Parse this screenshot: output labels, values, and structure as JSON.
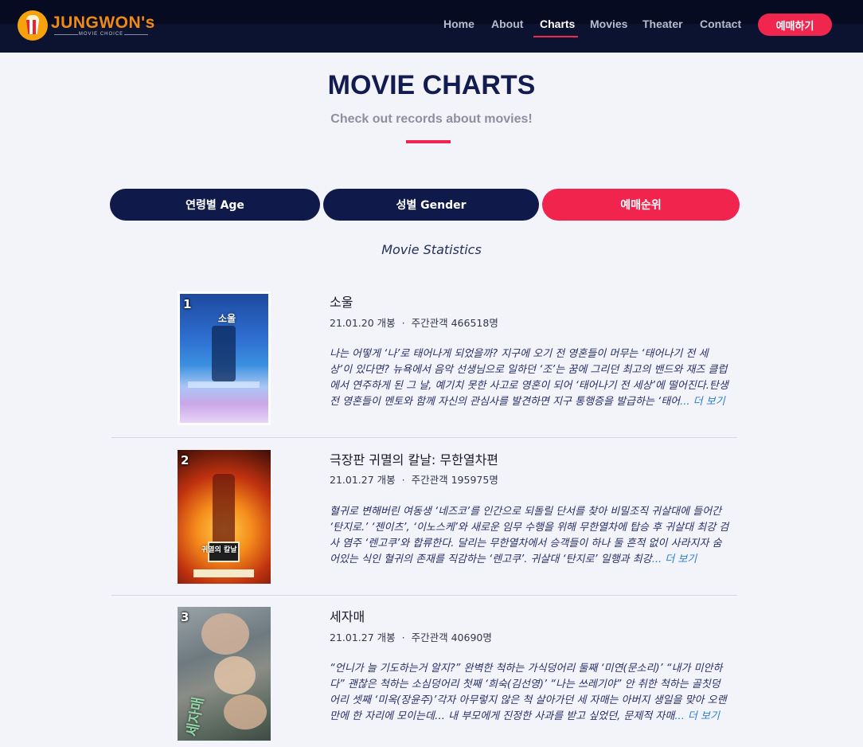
{
  "header": {
    "logo_text": "JUNGWON's",
    "logo_sub": "MOVIE CHOICE",
    "nav": [
      "Home",
      "About",
      "Charts",
      "Movies",
      "Theater",
      "Contact"
    ],
    "active_nav": "Charts",
    "reserve_label": "예매하기"
  },
  "page": {
    "title": "MOVIE CHARTS",
    "subtitle": "Check out records about movies!",
    "tabs": [
      {
        "label": "연령별 Age",
        "active": false
      },
      {
        "label": "성별 Gender",
        "active": false
      },
      {
        "label": "예매순위",
        "active": true
      }
    ],
    "stats_label": "Movie Statistics"
  },
  "movies": [
    {
      "rank": "1",
      "title": "소울",
      "release": "21.01.20 개봉",
      "audience": "주간관객 466518명",
      "description": "나는 어떻게 ‘나’로 태어나게 되었을까? 지구에 오기 전 영혼들이 머무는 ‘태어나기 전 세상’이 있다면? 뉴욕에서 음악 선생님으로 일하던 ‘조’는 꿈에 그리던 최고의 밴드와 재즈 클럽에서 연주하게 된 그 날, 예기치 못한 사고로 영혼이 되어 ‘태어나기 전 세상’에 떨어진다.탄생 전 영혼들이 멘토와 함께 자신의 관심사를 발견하면 지구 통행증을 발급하는 ‘태어",
      "more": "... 더 보기"
    },
    {
      "rank": "2",
      "title": "극장판 귀멸의 칼날: 무한열차편",
      "release": "21.01.27 개봉",
      "audience": "주간관객 195975명",
      "description": "혈귀로 변해버린 여동생 ‘네즈코’를 인간으로 되돌릴 단서를 찾아 비밀조직 귀살대에 들어간 ‘탄지로.’ ‘젠이츠’, ‘이노스케’와 새로운 임무 수행을 위해 무한열차에 탑승 후 귀살대 최강 검사 염주 ‘렌고쿠’와 합류한다. 달리는 무한열차에서 승객들이 하나 둘 흔적 없이 사라지자 숨어있는 식인 혈귀의 존재를 직감하는 ‘렌고쿠’. 귀살대 ‘탄지로’ 일행과 최강",
      "more": "... 더 보기"
    },
    {
      "rank": "3",
      "title": "세자매",
      "release": "21.01.27 개봉",
      "audience": "주간관객 40690명",
      "description": "“언니가 늘 기도하는거 알지?” 완벽한 척하는 가식덩어리 둘째 ‘미연(문소리)’ “내가 미안하다” 괜찮은 척하는 소심덩어리 첫째 ‘희숙(김선영)’ “나는 쓰레기야” 안 취한 척하는 골칫덩어리 셋째 ‘미옥(장윤주)’각자 아무렇지 않은 척 살아가던 세 자매는 아버지 생일을 맞아 오랜만에 한 자리에 모이는데… 내 부모에게 진정한 사과를 받고 싶었던, 문제적 자매",
      "more": "... 더 보기"
    }
  ],
  "posters": [
    {
      "title": "소울"
    },
    {
      "title": "귀멸의 칼날"
    },
    {
      "title": "세자매"
    }
  ]
}
